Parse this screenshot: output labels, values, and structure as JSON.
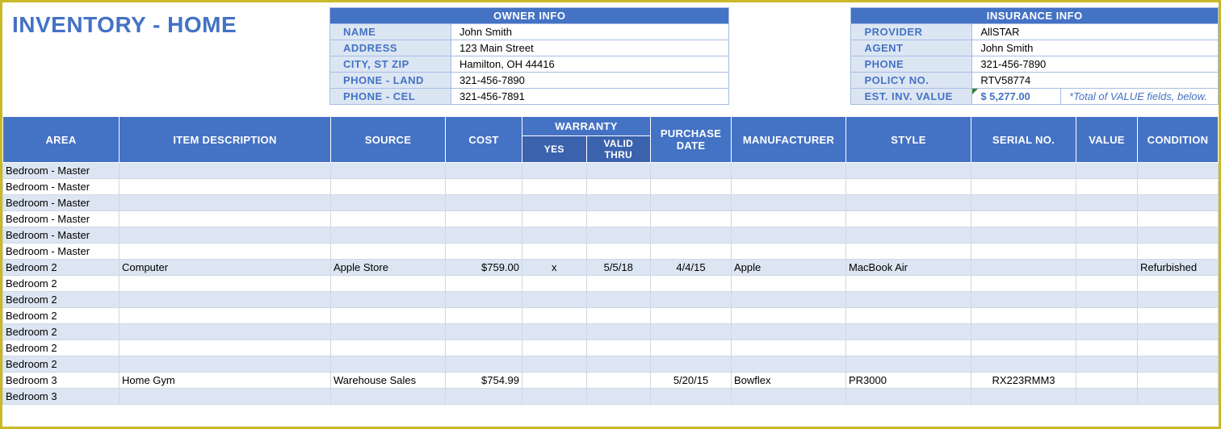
{
  "title": "INVENTORY - HOME",
  "owner": {
    "heading": "OWNER INFO",
    "rows": [
      {
        "label": "NAME",
        "value": "John Smith"
      },
      {
        "label": "ADDRESS",
        "value": "123 Main Street"
      },
      {
        "label": "CITY, ST  ZIP",
        "value": "Hamilton, OH  44416"
      },
      {
        "label": "PHONE - LAND",
        "value": "321-456-7890"
      },
      {
        "label": "PHONE - CEL",
        "value": "321-456-7891"
      }
    ]
  },
  "insurance": {
    "heading": "INSURANCE INFO",
    "rows": [
      {
        "label": "PROVIDER",
        "value": "AllSTAR"
      },
      {
        "label": "AGENT",
        "value": "John Smith"
      },
      {
        "label": "PHONE",
        "value": "321-456-7890"
      },
      {
        "label": "POLICY NO.",
        "value": "RTV58774"
      }
    ],
    "est_label": "EST. INV. VALUE",
    "est_value": "$       5,277.00",
    "est_note": "*Total of VALUE fields, below."
  },
  "columns": {
    "area": "AREA",
    "desc": "ITEM DESCRIPTION",
    "source": "SOURCE",
    "cost": "COST",
    "warranty": "WARRANTY",
    "wyes": "YES",
    "wthru": "VALID THRU",
    "pdate": "PURCHASE DATE",
    "manu": "MANUFACTURER",
    "style": "STYLE",
    "serial": "SERIAL NO.",
    "value": "VALUE",
    "cond": "CONDITION"
  },
  "rows": [
    {
      "area": "Bedroom - Master"
    },
    {
      "area": "Bedroom - Master"
    },
    {
      "area": "Bedroom - Master"
    },
    {
      "area": "Bedroom - Master"
    },
    {
      "area": "Bedroom - Master"
    },
    {
      "area": "Bedroom - Master"
    },
    {
      "area": "Bedroom 2",
      "desc": "Computer",
      "source": "Apple Store",
      "cost": "$759.00",
      "wyes": "x",
      "wthru": "5/5/18",
      "pdate": "4/4/15",
      "manu": "Apple",
      "style": "MacBook Air",
      "cond": "Refurbished"
    },
    {
      "area": "Bedroom 2"
    },
    {
      "area": "Bedroom 2"
    },
    {
      "area": "Bedroom 2"
    },
    {
      "area": "Bedroom 2"
    },
    {
      "area": "Bedroom 2"
    },
    {
      "area": "Bedroom 2"
    },
    {
      "area": "Bedroom 3",
      "desc": "Home Gym",
      "source": "Warehouse Sales",
      "cost": "$754.99",
      "pdate": "5/20/15",
      "manu": "Bowflex",
      "style": "PR3000",
      "serial": "RX223RMM3"
    },
    {
      "area": "Bedroom 3"
    }
  ]
}
